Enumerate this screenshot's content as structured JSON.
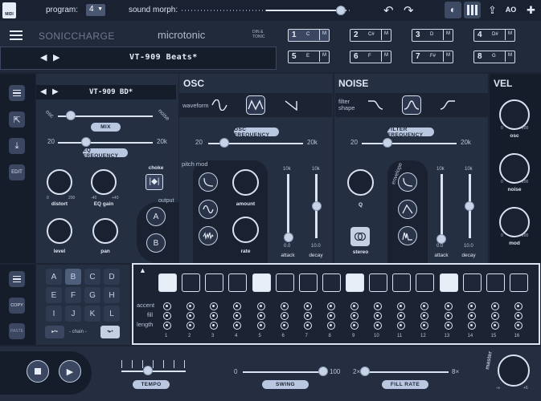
{
  "topbar": {
    "midi_label": "MIDI",
    "program_label": "program:",
    "program_value": "4",
    "sound_morph_label": "sound morph:",
    "sound_morph_value": 0.95
  },
  "header": {
    "brand": "SONICCHARGE",
    "product": "microtonic",
    "badge": "DIN & TONIC",
    "preset_name": "VT-909 Beats*"
  },
  "channels": [
    {
      "num": "1",
      "note": "C",
      "mute": "M"
    },
    {
      "num": "2",
      "note": "C#",
      "mute": "M"
    },
    {
      "num": "3",
      "note": "D",
      "mute": "M"
    },
    {
      "num": "4",
      "note": "D#",
      "mute": "M"
    },
    {
      "num": "5",
      "note": "E",
      "mute": "M"
    },
    {
      "num": "6",
      "note": "F",
      "mute": "M"
    },
    {
      "num": "7",
      "note": "F#",
      "mute": "M"
    },
    {
      "num": "8",
      "note": "G",
      "mute": "M"
    }
  ],
  "drum": {
    "name": "VT-909 BD*",
    "mix_left": "osc",
    "mix_right": "noise",
    "mix_label": "MIX",
    "eq_left": "20",
    "eq_right": "20k",
    "eq_label": "EQ FREQUENCY",
    "distort_label": "distort",
    "distort_min": "0",
    "distort_max": "200",
    "eqgain_label": "EQ gain",
    "eqgain_min": "-40",
    "eqgain_max": "+40",
    "level_label": "level",
    "pan_label": "pan",
    "choke_label": "choke",
    "output_label": "output",
    "output_a": "A",
    "output_b": "B",
    "edit_label": "EDIT"
  },
  "osc": {
    "title": "OSC",
    "waveform_label": "waveform",
    "freq_left": "20",
    "freq_right": "20k",
    "freq_label": "OSC FREQUENCY",
    "pitchmod_label": "pitch mod",
    "amount_label": "amount",
    "rate_label": "rate",
    "attack_label": "attack",
    "decay_label": "decay",
    "attack_top": "10k",
    "attack_val": "0.0",
    "decay_top": "10k",
    "decay_val": "10.0"
  },
  "noise": {
    "title": "NOISE",
    "filter_shape_label": "filter shape",
    "freq_left": "20",
    "freq_right": "20k",
    "freq_label": "FILTER FREQUENCY",
    "q_label": "Q",
    "envelope_label": "envelope",
    "stereo_label": "stereo",
    "attack_label": "attack",
    "decay_label": "decay",
    "attack_top": "10k",
    "attack_val": "0.0",
    "decay_top": "10k",
    "decay_val": "10.0"
  },
  "vel": {
    "title": "VEL",
    "osc_label": "osc",
    "noise_label": "noise",
    "mod_label": "mod",
    "min": "0",
    "max": "200"
  },
  "patterns": {
    "letters": [
      "A",
      "B",
      "C",
      "D",
      "E",
      "F",
      "G",
      "H",
      "I",
      "J",
      "K",
      "L"
    ],
    "selected": "B",
    "copy_label": "COPY",
    "paste_label": "PASTE",
    "chain_label": "- chain -"
  },
  "sequencer": {
    "row_labels": [
      "accent",
      "fill",
      "length"
    ],
    "steps_on": [
      1,
      5,
      9,
      13
    ],
    "step_numbers": [
      "1",
      "2",
      "3",
      "4",
      "5",
      "6",
      "7",
      "8",
      "9",
      "10",
      "11",
      "12",
      "13",
      "14",
      "15",
      "16"
    ]
  },
  "transport": {
    "tempo_label": "TEMPO",
    "swing_label": "SWING",
    "swing_min": "0",
    "swing_max": "100",
    "fill_label": "FILL RATE",
    "fill_min": "2×",
    "fill_max": "8×",
    "master_label": "master",
    "master_min": "-∞",
    "master_max": "+6"
  }
}
